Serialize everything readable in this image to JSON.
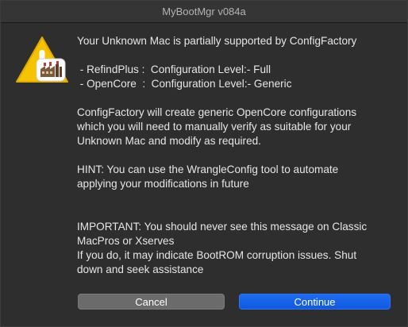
{
  "window": {
    "title": "MyBootMgr v084a"
  },
  "icon": {
    "name": "warning-triangle-icon",
    "badge": "app-factory-badge-icon",
    "accent_color": "#f5c300"
  },
  "message": {
    "line1": "Your Unknown Mac is partially supported by ConfigFactory",
    "line2": " - RefindPlus :  Configuration Level:- Full",
    "line3": " - OpenCore  :  Configuration Level:- Generic",
    "line4": "ConfigFactory will create generic OpenCore configurations",
    "line5": "which you will need to manually verify as suitable for your",
    "line6": "Unknown Mac and modify as required.",
    "line7": "HINT: You can use the WrangleConfig tool to automate",
    "line8": "applying your modifications in future",
    "line9": "IMPORTANT: You should never see this message on Classic",
    "line10": "MacPros or Xserves",
    "line11": "If you do, it may indicate BootROM corruption issues. Shut",
    "line12": "down and seek assistance"
  },
  "buttons": {
    "cancel": "Cancel",
    "continue": "Continue",
    "primary_color": "#1565ea"
  }
}
